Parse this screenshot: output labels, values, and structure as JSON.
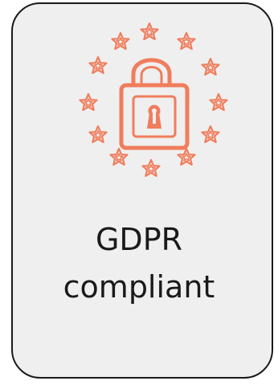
{
  "badge": {
    "line1": "GDPR",
    "line2": "compliant",
    "icon": "eu-stars-padlock-icon",
    "accent_color": "#f07d5c",
    "text_color": "#1a1a1a",
    "card_color": "#efefef"
  }
}
